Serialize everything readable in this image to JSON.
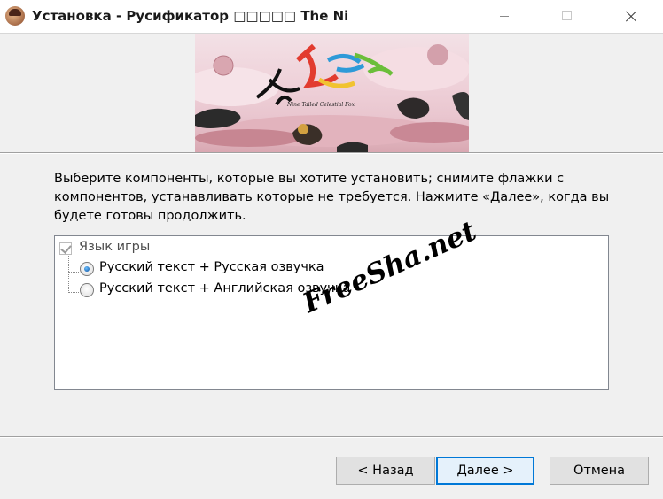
{
  "window": {
    "title": "Установка - Русификатор □□□□□ The Ni",
    "icon": "app-icon",
    "controls": {
      "minimize": "minimize-icon",
      "maximize": "maximize-icon",
      "close": "close-icon"
    }
  },
  "banner": {
    "logo_subtitle": "Nine Tailed Celestial Fox"
  },
  "instructions": "Выберите компоненты, которые вы хотите установить; снимите флажки с компонентов, устанавливать которые не требуется. Нажмите «Далее», когда вы будете готовы продолжить.",
  "components": {
    "group": {
      "label": "Язык игры",
      "checked": true,
      "disabled": true
    },
    "options": [
      {
        "label": "Русский текст + Русская озвучка",
        "selected": true
      },
      {
        "label": "Русский текст + Английская озвучка",
        "selected": false
      }
    ]
  },
  "watermark": "FreeSha.net",
  "buttons": {
    "back": "< Назад",
    "next": "Далее >",
    "cancel": "Отмена"
  },
  "colors": {
    "accent": "#0078d7",
    "window_bg": "#f0f0f0"
  }
}
